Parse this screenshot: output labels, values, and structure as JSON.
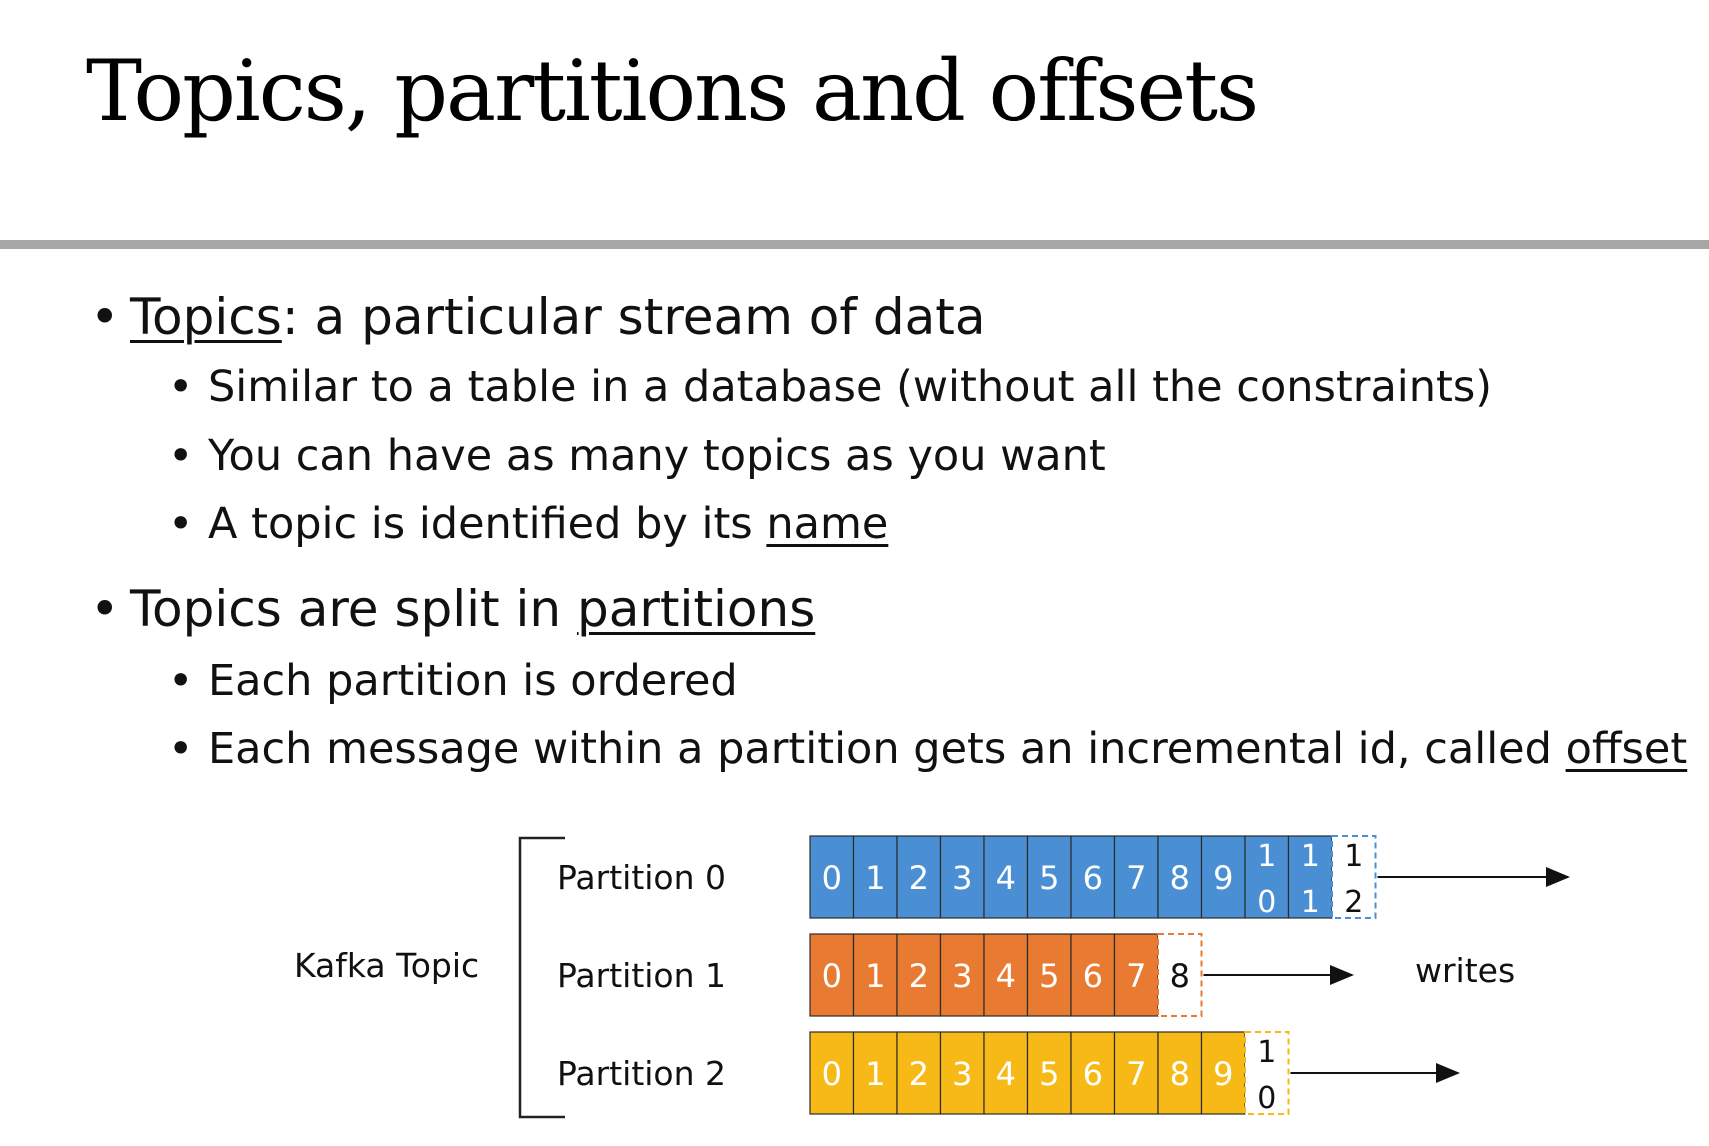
{
  "slide": {
    "title": "Topics, partitions and offsets",
    "bullets": [
      {
        "level": 1,
        "underlined": "Topics",
        "text": ": a particular stream of data"
      },
      {
        "level": 2,
        "text": "Similar to a table in a database (without all the constraints)"
      },
      {
        "level": 2,
        "text": "You can have as many topics as you want"
      },
      {
        "level": 2,
        "text": "A topic is identified by its ",
        "underlined": "name"
      },
      {
        "level": 1,
        "text": "Topics are split in ",
        "underlined": "partitions"
      },
      {
        "level": 2,
        "text": "Each partition is ordered"
      },
      {
        "level": 2,
        "text": "Each message within a partition gets an incremental id, called ",
        "underlined": "offset"
      }
    ],
    "bullet_glyph": "•"
  },
  "diagram": {
    "topic_label": "Kafka Topic",
    "writes_label": "writes",
    "partitions": [
      {
        "label": "Partition 0",
        "color": "#4a8fd4",
        "cells": [
          "0",
          "1",
          "2",
          "3",
          "4",
          "5",
          "6",
          "7",
          "8",
          "9",
          "10",
          "11"
        ],
        "next": "12"
      },
      {
        "label": "Partition 1",
        "color": "#e87a32",
        "cells": [
          "0",
          "1",
          "2",
          "3",
          "4",
          "5",
          "6",
          "7"
        ],
        "next": "8"
      },
      {
        "label": "Partition 2",
        "color": "#f7b916",
        "cells": [
          "0",
          "1",
          "2",
          "3",
          "4",
          "5",
          "6",
          "7",
          "8",
          "9"
        ],
        "next": "10"
      }
    ]
  }
}
